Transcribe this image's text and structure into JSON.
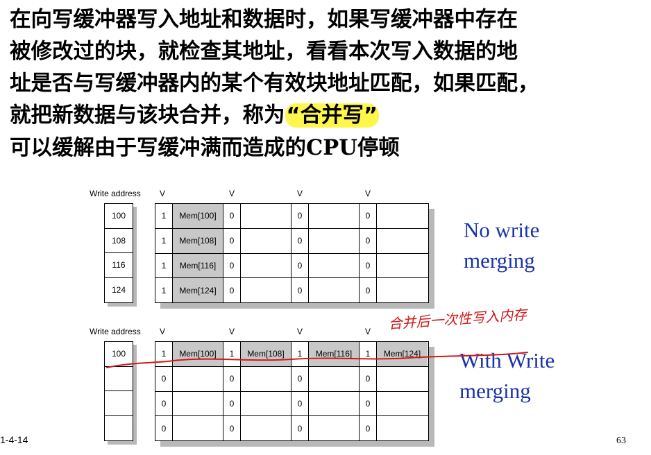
{
  "text": {
    "line1": "在向写缓冲器写入地址和数据时，如果写缓冲器中存在",
    "line2": "被修改过的块，就检查其地址，看看本次写入数据的地",
    "line3": "址是否与写缓冲器内的某个有效块地址匹配，如果匹配，",
    "line4_pre": "就把新数据与该块合并，称为",
    "line4_hl": "“合并写”",
    "line5_pre": "可以缓解由于写缓冲满而造成的",
    "line5_cpu": "CPU",
    "line5_post": "停顿"
  },
  "diagrams": {
    "top": {
      "header_addr": "Write address",
      "header_v": "V",
      "caption_l1": "No write",
      "caption_l2": "merging",
      "addresses": [
        "100",
        "108",
        "116",
        "124"
      ],
      "rows": [
        [
          {
            "v": "1",
            "d": "Mem[100]"
          },
          {
            "v": "0",
            "d": ""
          },
          {
            "v": "0",
            "d": ""
          },
          {
            "v": "0",
            "d": ""
          }
        ],
        [
          {
            "v": "1",
            "d": "Mem[108]"
          },
          {
            "v": "0",
            "d": ""
          },
          {
            "v": "0",
            "d": ""
          },
          {
            "v": "0",
            "d": ""
          }
        ],
        [
          {
            "v": "1",
            "d": "Mem[116]"
          },
          {
            "v": "0",
            "d": ""
          },
          {
            "v": "0",
            "d": ""
          },
          {
            "v": "0",
            "d": ""
          }
        ],
        [
          {
            "v": "1",
            "d": "Mem[124]"
          },
          {
            "v": "0",
            "d": ""
          },
          {
            "v": "0",
            "d": ""
          },
          {
            "v": "0",
            "d": ""
          }
        ]
      ]
    },
    "bottom": {
      "header_addr": "Write address",
      "header_v": "V",
      "caption_l1": "With Write",
      "caption_l2": "merging",
      "addresses": [
        "100",
        "",
        "",
        ""
      ],
      "rows": [
        [
          {
            "v": "1",
            "d": "Mem[100]"
          },
          {
            "v": "1",
            "d": "Mem[108]"
          },
          {
            "v": "1",
            "d": "Mem[116]"
          },
          {
            "v": "1",
            "d": "Mem[124]"
          }
        ],
        [
          {
            "v": "0",
            "d": ""
          },
          {
            "v": "0",
            "d": ""
          },
          {
            "v": "0",
            "d": ""
          },
          {
            "v": "0",
            "d": ""
          }
        ],
        [
          {
            "v": "0",
            "d": ""
          },
          {
            "v": "0",
            "d": ""
          },
          {
            "v": "0",
            "d": ""
          },
          {
            "v": "0",
            "d": ""
          }
        ],
        [
          {
            "v": "0",
            "d": ""
          },
          {
            "v": "0",
            "d": ""
          },
          {
            "v": "0",
            "d": ""
          },
          {
            "v": "0",
            "d": ""
          }
        ]
      ]
    }
  },
  "annotation": "合并后一次性写入内存",
  "footer": {
    "date": "1-4-14",
    "page": "63"
  },
  "colors": {
    "caption": "#1a33a6",
    "highlight": "#fff64d",
    "filled_cell": "#c8c8c8",
    "handwriting": "#d01818"
  }
}
